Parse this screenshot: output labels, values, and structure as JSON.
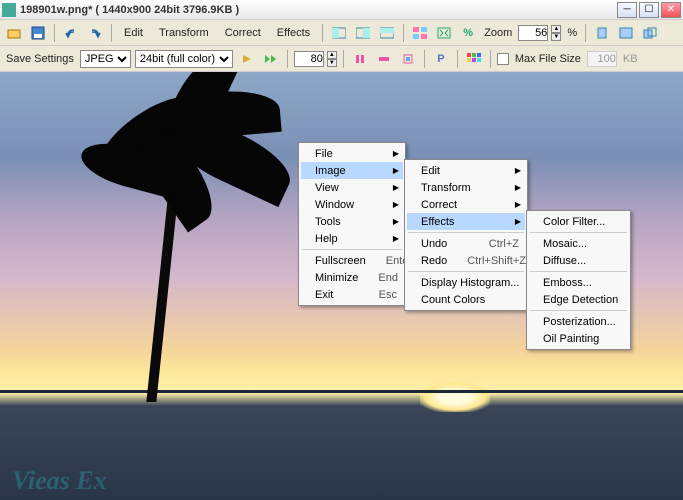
{
  "title": "198901w.png*  ( 1440x900  24bit  3796.9KB )",
  "menubar": {
    "edit": "Edit",
    "transform": "Transform",
    "correct": "Correct",
    "effects": "Effects",
    "zoom": "Zoom"
  },
  "zoom": {
    "value": "56",
    "unit": "%"
  },
  "save": {
    "label": "Save Settings",
    "format": "JPEG",
    "depth": "24bit (full color)",
    "val80": "80",
    "maxfs": "Max File Size",
    "size": "100",
    "kb": "KB"
  },
  "watermark": "Vieas Ex",
  "menu1": {
    "file": "File",
    "image": "Image",
    "view": "View",
    "window": "Window",
    "tools": "Tools",
    "help": "Help",
    "fullscreen": "Fullscreen",
    "enter": "Enter",
    "minimize": "Minimize",
    "end": "End",
    "exit": "Exit",
    "esc": "Esc"
  },
  "menu2": {
    "edit": "Edit",
    "transform": "Transform",
    "correct": "Correct",
    "effects": "Effects",
    "undo": "Undo",
    "ctrlz": "Ctrl+Z",
    "redo": "Redo",
    "csz": "Ctrl+Shift+Z",
    "disphist": "Display Histogram...",
    "countcol": "Count Colors"
  },
  "menu3": {
    "colorfilter": "Color Filter...",
    "mosaic": "Mosaic...",
    "diffuse": "Diffuse...",
    "emboss": "Emboss...",
    "edgedet": "Edge Detection",
    "poster": "Posterization...",
    "oilpaint": "Oil Painting"
  }
}
